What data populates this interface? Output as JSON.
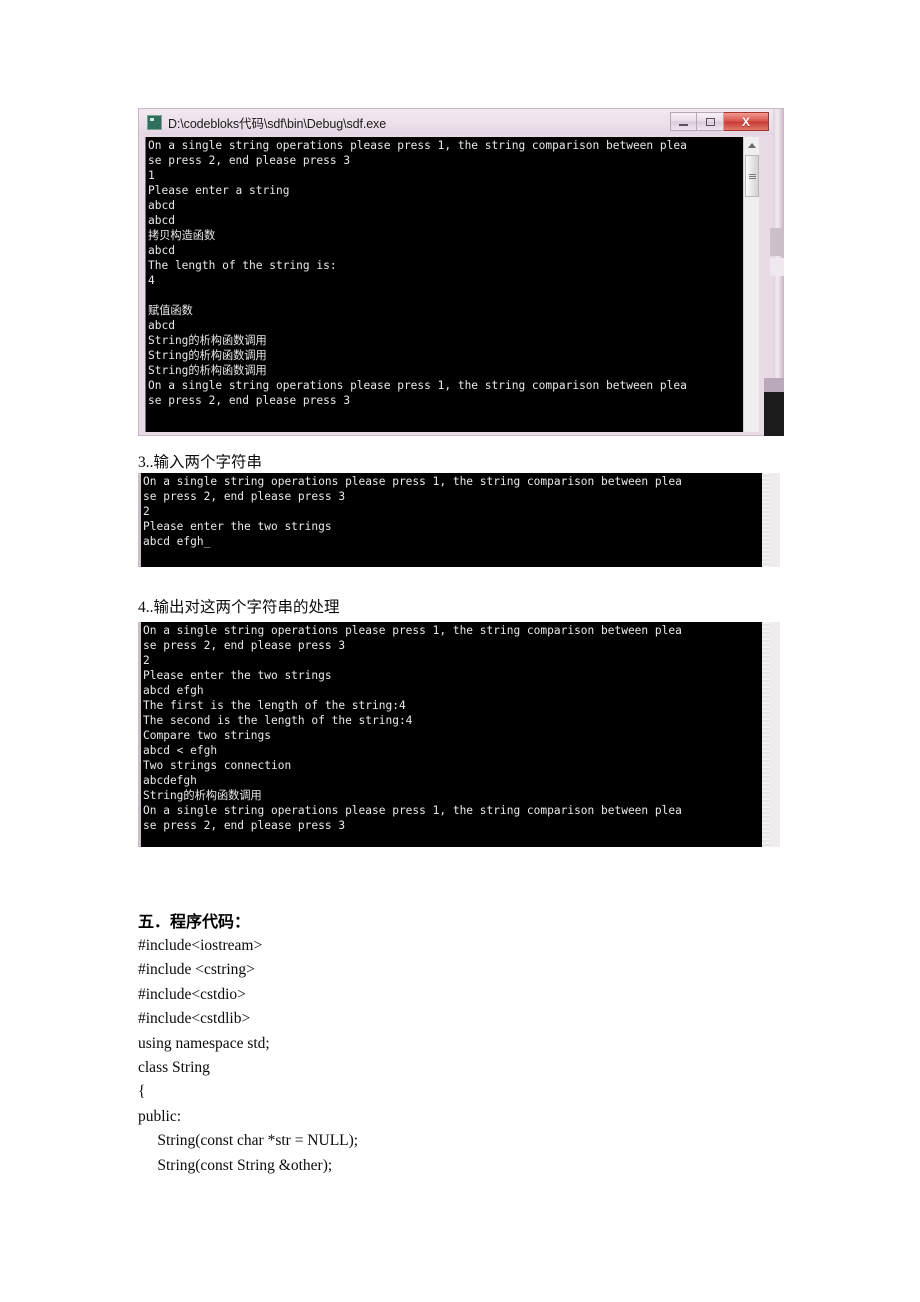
{
  "document": {
    "type": "lab-report-page",
    "language": "zh-CN"
  },
  "window1": {
    "title": "D:\\codebloks代码\\sdf\\bin\\Debug\\sdf.exe",
    "icon": "console-app-icon",
    "buttons": {
      "minimize": "–",
      "maximize": "□",
      "close": "X"
    },
    "scrollbar": {
      "up_arrow": "▲",
      "thumb": "≡"
    },
    "console_text": "On a single string operations please press 1, the string comparison between plea\nse press 2, end please press 3\n1\nPlease enter a string\nabcd\nabcd\n拷贝构造函数\nabcd\nThe length of the string is:\n4\n\n赋值函数\nabcd\nString的析构函数调用\nString的析构函数调用\nString的析构函数调用\nOn a single string operations please press 1, the string comparison between plea\nse press 2, end please press 3"
  },
  "caption3": "3..输入两个字符串",
  "window2": {
    "console_text": "On a single string operations please press 1, the string comparison between plea\nse press 2, end please press 3\n2\nPlease enter the two strings\nabcd efgh_"
  },
  "caption4": "4..输出对这两个字符串的处理",
  "window3": {
    "console_text": "On a single string operations please press 1, the string comparison between plea\nse press 2, end please press 3\n2\nPlease enter the two strings\nabcd efgh\nThe first is the length of the string:4\nThe second is the length of the string:4\nCompare two strings\nabcd < efgh\nTwo strings connection\nabcdefgh\nString的析构函数调用\nOn a single string operations please press 1, the string comparison between plea\nse press 2, end please press 3"
  },
  "code_section": {
    "heading": "五．程序代码：",
    "lines": [
      "#include<iostream>",
      "#include <cstring>",
      "#include<cstdio>",
      "#include<cstdlib>",
      "using namespace std;",
      "class String",
      "{",
      "public:",
      "     String(const char *str = NULL);",
      "     String(const String &other);"
    ]
  },
  "colors": {
    "console_bg": "#000000",
    "console_fg": "#e9e9e9",
    "titlebar": "#ece0ea",
    "close_button": "#c63a30",
    "page_bg": "#ffffff"
  }
}
